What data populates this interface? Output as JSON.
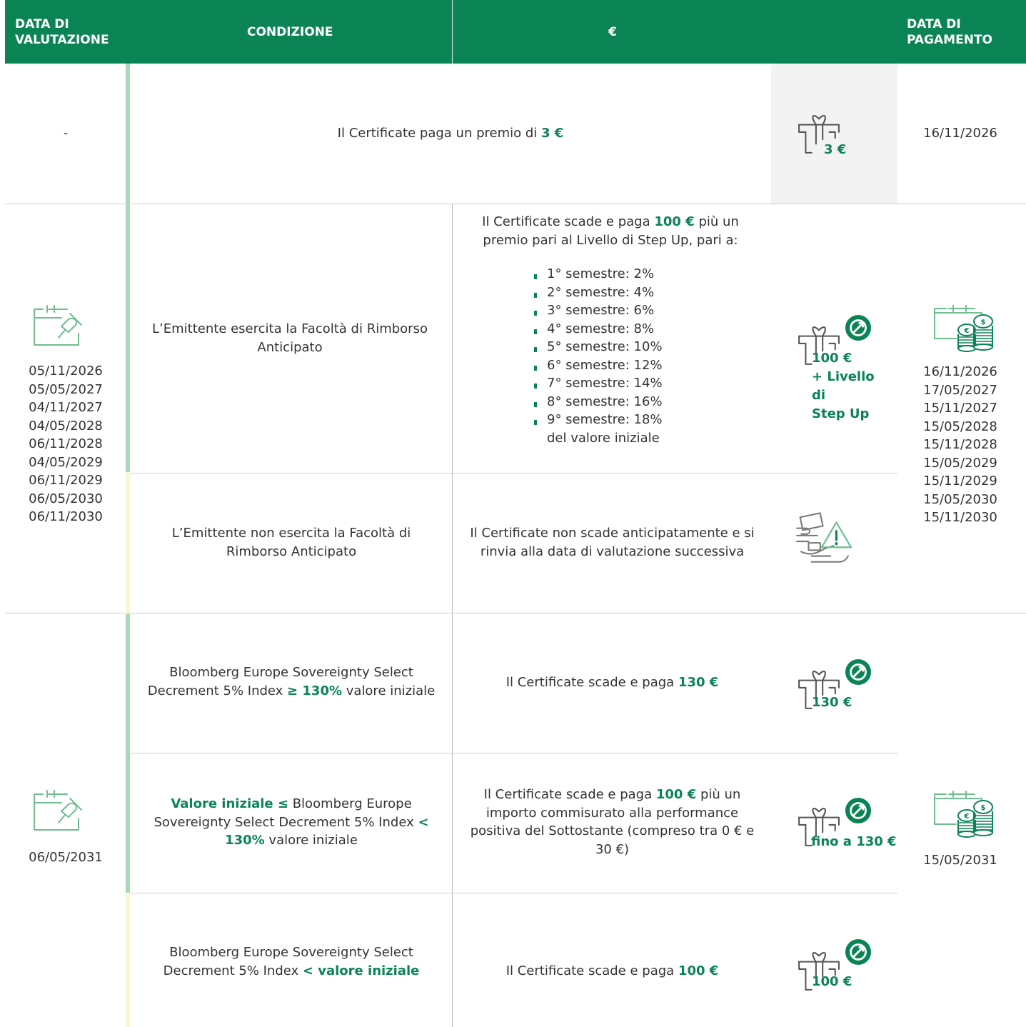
{
  "header": {
    "col1": [
      "DATA DI",
      "VALUTAZIONE"
    ],
    "col2": "CONDIZIONE",
    "col3": "€",
    "col4": [
      "DATA DI",
      "PAGAMENTO"
    ]
  },
  "colors": {
    "brand": "#0b8455",
    "bar_dark": "#a9d8b8",
    "bar_light": "#fbf6cf"
  },
  "row1": {
    "eval_date": "-",
    "condition_pre": "Il Certificate paga un premio di ",
    "condition_bold": "3 €",
    "icon": "gift-icon",
    "icon_label": "3 €",
    "payment_date": "16/11/2026"
  },
  "row2": {
    "eval_icon": "calendar-pin-icon",
    "eval_dates": [
      "05/11/2026",
      "05/05/2027",
      "04/11/2027",
      "04/05/2028",
      "06/11/2028",
      "04/05/2029",
      "06/11/2029",
      "06/05/2030",
      "06/11/2030"
    ],
    "payment_icon": "calendar-coins-icon",
    "payment_dates": [
      "16/11/2026",
      "17/05/2027",
      "15/11/2027",
      "15/05/2028",
      "15/11/2028",
      "15/05/2029",
      "15/11/2029",
      "15/05/2030",
      "15/11/2030"
    ],
    "a": {
      "condition": "L’Emittente esercita la Facoltà di Rimborso Anticipato",
      "outcome_pre": "Il Certificate scade e paga ",
      "outcome_bold": "100 €",
      "outcome_post": " più un premio pari al Livello di Step Up, pari a:",
      "bullets": [
        "1° semestre: 2%",
        "2° semestre: 4%",
        "3° semestre: 6%",
        "4° semestre: 8%",
        "5° semestre: 10%",
        "6° semestre: 12%",
        "7° semestre: 14%",
        "8° semestre: 16%",
        "9° semestre: 18%"
      ],
      "outcome_tail": "del valore iniziale",
      "icon": "gift-check-icon",
      "icon_label": [
        "100 €",
        "+ Livello di",
        "Step Up"
      ]
    },
    "b": {
      "condition": "L’Emittente non esercita la Facoltà di Rimborso Anticipato",
      "outcome": "Il Certificate non scade anticipatamente e si rinvia alla data di valutazione successiva",
      "icon": "hand-money-warning-icon"
    }
  },
  "row3": {
    "eval_icon": "calendar-pin-icon",
    "eval_date": "06/05/2031",
    "payment_icon": "calendar-coins-icon",
    "payment_date": "15/05/2031",
    "a": {
      "condition_pre": "Bloomberg Europe Sovereignty Select Decrement 5% Index ",
      "condition_bold": "≥ 130%",
      "condition_post": " valore iniziale",
      "outcome_pre": "Il Certificate scade e paga ",
      "outcome_bold": "130 €",
      "icon": "gift-check-icon",
      "icon_label": "130 €"
    },
    "b": {
      "condition_bold1": "Valore iniziale ≤",
      "condition_mid": " Bloomberg Europe Sovereignty Select Decrement 5% Index ",
      "condition_bold2": "< 130%",
      "condition_post": " valore iniziale",
      "outcome_pre": "Il Certificate scade e paga ",
      "outcome_bold": "100 €",
      "outcome_post": " più un importo commisurato alla performance positiva del Sottostante (compreso tra 0 € e 30 €)",
      "icon": "gift-check-icon",
      "icon_label": "fino a 130 €"
    },
    "c": {
      "condition_pre": "Bloomberg Europe Sovereignty Select Decrement 5% Index ",
      "condition_bold": "< valore iniziale",
      "outcome_pre": "Il Certificate scade e paga ",
      "outcome_bold": "100 €",
      "icon": "gift-check-icon",
      "icon_label": "100 €"
    }
  }
}
